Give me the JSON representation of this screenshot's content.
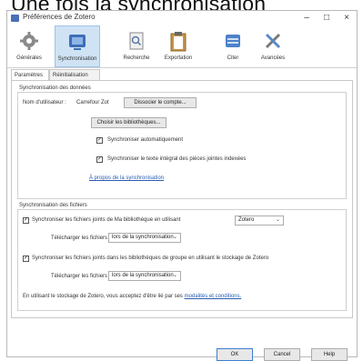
{
  "caption": "Une fois la synchronisation",
  "window": {
    "title": "Préférences de Zotero",
    "controls": {
      "minimize": "–",
      "maximize": "□",
      "close": "×"
    }
  },
  "toolbar": [
    {
      "label": "Générales",
      "icon": "gear-icon"
    },
    {
      "label": "Synchronisation",
      "icon": "sync-icon",
      "active": true
    },
    {
      "label": "Recherche",
      "icon": "search-icon"
    },
    {
      "label": "Exportation",
      "icon": "clipboard-icon"
    },
    {
      "label": "Citer",
      "icon": "folder-icon"
    },
    {
      "label": "Avancées",
      "icon": "tools-icon"
    }
  ],
  "tabs": [
    {
      "label": "Paramètres",
      "active": true
    },
    {
      "label": "Réinitialisation"
    }
  ],
  "data_sync": {
    "title": "Synchronisation des données",
    "username_label": "Nom d'utilisateur :",
    "username_value": "Carrefour Zot",
    "unlink_button": "Dissocier le compte...",
    "choose_libraries_button": "Choisir les bibliothèques...",
    "auto_sync_label": "Synchroniser automatiquement",
    "auto_sync_checked": true,
    "fulltext_label": "Synchroniser le texte intégral des pièces jointes indexées",
    "fulltext_checked": true,
    "about_link": "À propos de la synchronisation"
  },
  "file_sync": {
    "title": "Synchronisation des fichiers",
    "my_library_label": "Synchroniser les fichiers joints de Ma bibliothèque en utilisant",
    "my_library_checked": true,
    "my_library_service": "Zotero",
    "download_label_1": "Télécharger les fichiers",
    "download_value_1": "lors de la synchronisation",
    "group_label": "Synchroniser les fichiers joints dans les bibliothèques de groupe en utilisant le stockage de Zotero",
    "group_checked": true,
    "download_label_2": "Télécharger les fichiers",
    "download_value_2": "lors de la synchronisation",
    "terms_prefix": "En utilisant le stockage de Zotero, vous acceptez d'être lié par ses",
    "terms_link": "modalités et conditions."
  },
  "footer": {
    "ok": "OK",
    "cancel": "Cancel",
    "help": "Help"
  }
}
